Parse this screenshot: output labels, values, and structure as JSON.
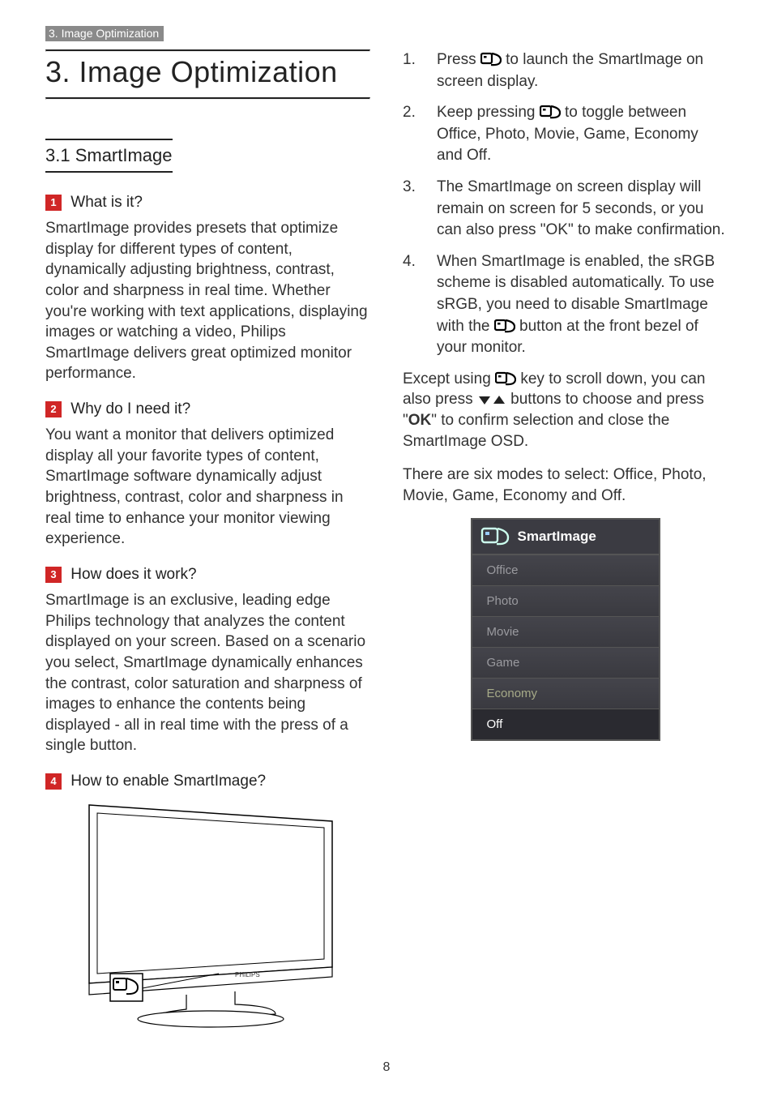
{
  "header_tag": "3. Image Optimization",
  "chapter_title": "3.  Image Optimization",
  "section_title": "3.1  SmartImage",
  "q1": {
    "num": "1",
    "title": "What is it?"
  },
  "p1": "SmartImage provides presets that optimize display for different types of content, dynamically adjusting brightness, contrast, color and sharpness in real time. Whether you're working with text applications, displaying images or watching a video, Philips SmartImage delivers great optimized monitor performance.",
  "q2": {
    "num": "2",
    "title": "Why do I need it?"
  },
  "p2": "You want a monitor that delivers optimized display all your favorite types of content, SmartImage software dynamically adjust brightness, contrast, color and sharpness in real time to enhance your monitor viewing experience.",
  "q3": {
    "num": "3",
    "title": "How does it work?"
  },
  "p3": "SmartImage is an exclusive, leading edge Philips technology that analyzes the content displayed on your screen. Based on a scenario you select, SmartImage dynamically enhances the contrast, color saturation and sharpness of images to enhance the contents being displayed - all in real time with the press of a single button.",
  "q4": {
    "num": "4",
    "title": "How to enable SmartImage?"
  },
  "steps": {
    "s1a": "Press ",
    "s1b": " to launch the SmartImage on screen display.",
    "s2a": "Keep pressing ",
    "s2b": " to toggle between Office, Photo, Movie, Game, Economy and Off.",
    "s3": "The SmartImage on screen display will remain on screen for 5 seconds, or you can also press \"OK\" to make confirmation.",
    "s4a": "When SmartImage is enabled, the sRGB scheme is disabled automatically. To use sRGB, you need to disable SmartImage with the ",
    "s4b": " button at the front bezel of your monitor."
  },
  "except": {
    "a": "Except using ",
    "b": " key to scroll down, you can also press ",
    "c": " buttons to choose and press \"",
    "ok": "OK",
    "d": "\" to confirm selection and close the SmartImage OSD."
  },
  "modes_text": "There are six modes to select: Office, Photo, Movie, Game, Economy and Off.",
  "osd": {
    "title": "SmartImage",
    "items": [
      "Office",
      "Photo",
      "Movie",
      "Game",
      "Economy",
      "Off"
    ]
  },
  "page_number": "8"
}
